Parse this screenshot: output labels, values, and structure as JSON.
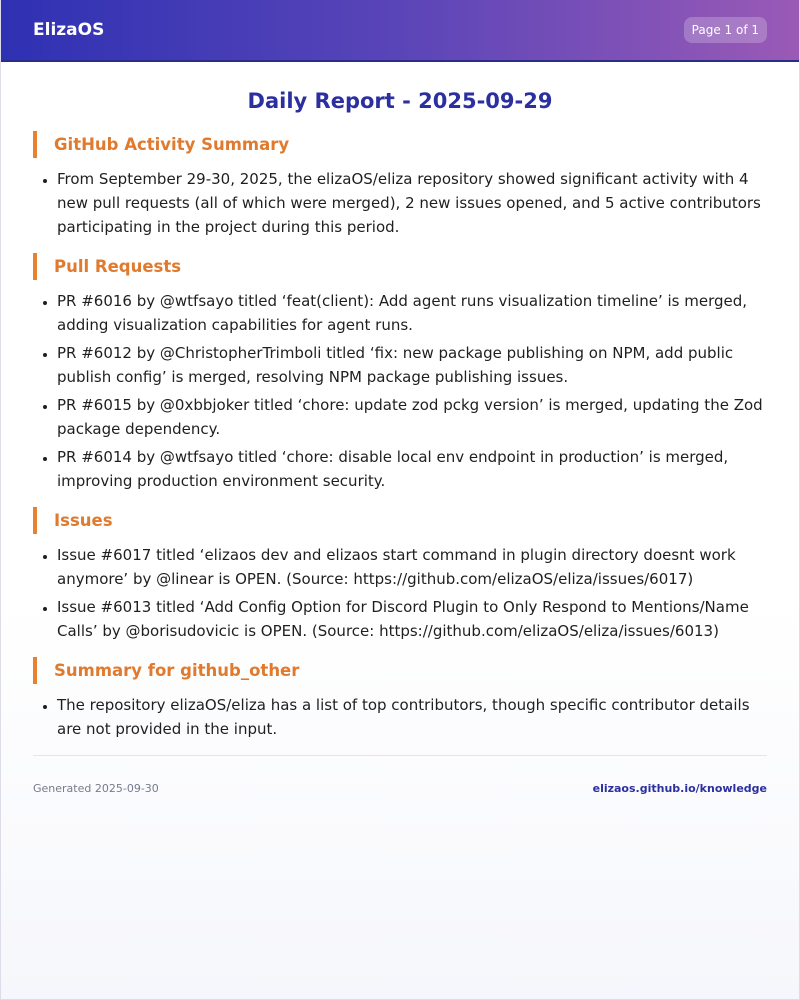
{
  "header": {
    "brand": "ElizaOS",
    "page_indicator": "Page 1 of 1"
  },
  "report": {
    "title": "Daily Report - 2025-09-29"
  },
  "sections": [
    {
      "heading": "GitHub Activity Summary",
      "items": [
        "From September 29-30, 2025, the elizaOS/eliza repository showed significant activity with 4 new pull requests (all of which were merged), 2 new issues opened, and 5 active contributors participating in the project during this period."
      ]
    },
    {
      "heading": "Pull Requests",
      "items": [
        "PR #6016 by @wtfsayo titled ‘feat(client): Add agent runs visualization timeline’ is merged, adding visualization capabilities for agent runs.",
        "PR #6012 by @ChristopherTrimboli titled ‘fix: new package publishing on NPM, add public publish config’ is merged, resolving NPM package publishing issues.",
        "PR #6015 by @0xbbjoker titled ‘chore: update zod pckg version’ is merged, updating the Zod package dependency.",
        "PR #6014 by @wtfsayo titled ‘chore: disable local env endpoint in production’ is merged, improving production environment security."
      ]
    },
    {
      "heading": "Issues",
      "items": [
        "Issue #6017 titled ‘elizaos dev and elizaos start command in plugin directory doesnt work anymore’ by @linear is OPEN. (Source: https://github.com/elizaOS/eliza/issues/6017)",
        "Issue #6013 titled ‘Add Config Option for Discord Plugin to Only Respond to Mentions/Name Calls’ by @borisudovicic is OPEN. (Source: https://github.com/elizaOS/eliza/issues/6013)"
      ]
    },
    {
      "heading": "Summary for github_other",
      "items": [
        "The repository elizaOS/eliza has a list of top contributors, though specific contributor details are not provided in the input."
      ]
    }
  ],
  "footer": {
    "generated": "Generated 2025-09-30",
    "link": "elizaos.github.io/knowledge"
  }
}
